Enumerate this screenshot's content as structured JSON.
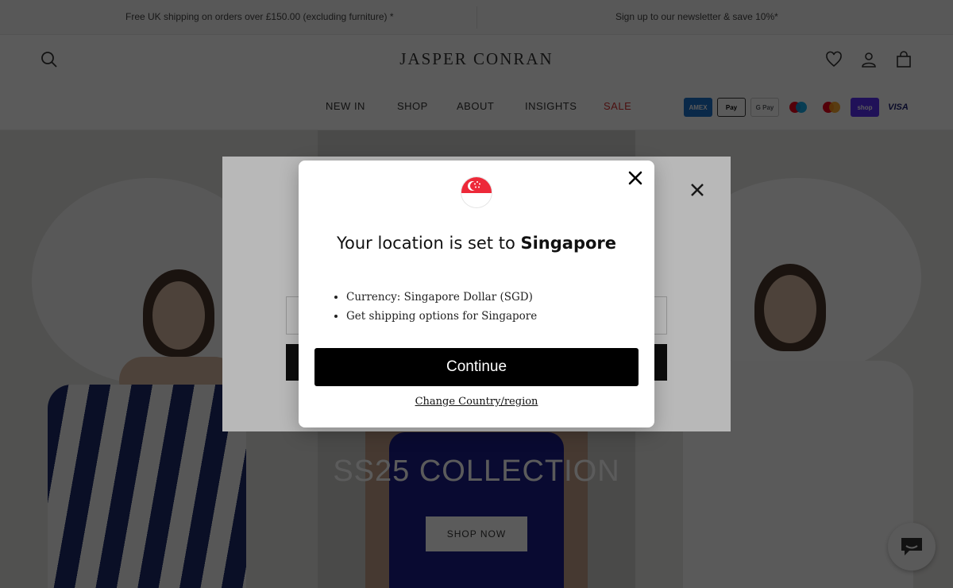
{
  "announcement": {
    "left": "Free UK shipping on orders over £150.00 (excluding furniture) *",
    "right": "Sign up to our newsletter & save 10%*"
  },
  "header": {
    "logo": "JASPER CONRAN",
    "icons": [
      "search-icon",
      "heart-icon",
      "account-icon",
      "bag-icon"
    ]
  },
  "nav": {
    "items": [
      "NEW IN",
      "SHOP",
      "ABOUT",
      "INSIGHTS",
      "SALE"
    ],
    "sale_color": "#d32f2f"
  },
  "payments": [
    {
      "name": "amex",
      "label": "AMEX",
      "bg": "#1f72cd",
      "fg": "#ffffff"
    },
    {
      "name": "apple-pay",
      "label": "Pay",
      "bg": "#ffffff",
      "fg": "#000000"
    },
    {
      "name": "google-pay",
      "label": "G Pay",
      "bg": "#ffffff",
      "fg": "#5f6368"
    },
    {
      "name": "maestro",
      "label": "",
      "bg": "#ffffff",
      "fg": "#000000"
    },
    {
      "name": "mastercard",
      "label": "",
      "bg": "#ffffff",
      "fg": "#000000"
    },
    {
      "name": "shop-pay",
      "label": "shop",
      "bg": "#5a31f4",
      "fg": "#ffffff"
    },
    {
      "name": "visa",
      "label": "VISA",
      "bg": "#ffffff",
      "fg": "#1a1f71"
    }
  ],
  "hero": {
    "title": "SS25 COLLECTION",
    "button": "SHOP NOW"
  },
  "modal": {
    "flag": "singapore-flag-icon",
    "title_prefix": "Your location is set to ",
    "title_country": "Singapore",
    "bullets": [
      "Currency: Singapore Dollar (SGD)",
      "Get shipping options for Singapore"
    ],
    "continue_label": "Continue",
    "change_label": "Change Country/region"
  },
  "colors": {
    "accent": "#000000",
    "flag_red": "#ed2939"
  }
}
